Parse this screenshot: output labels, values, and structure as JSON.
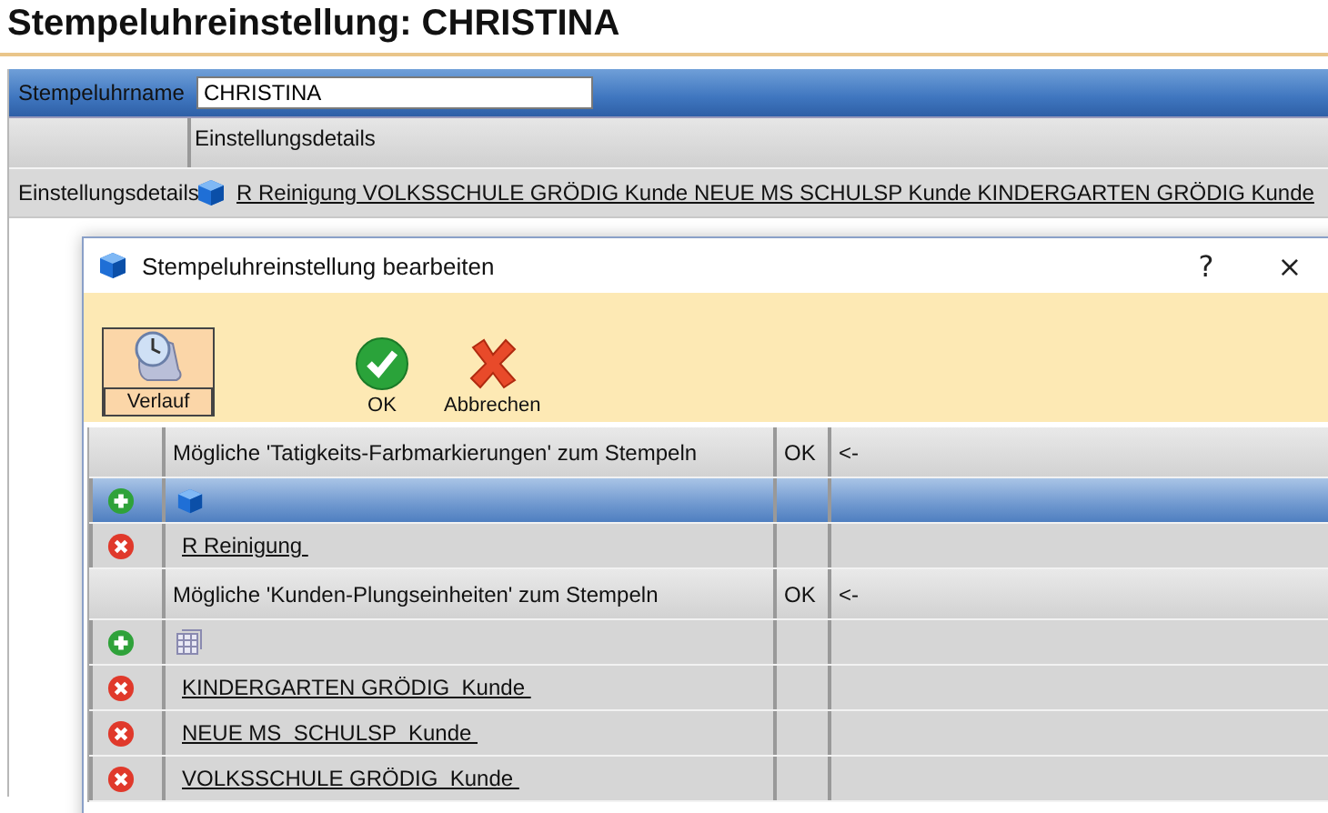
{
  "page_title": "Stempeluhreinstellung: CHRISTINA",
  "form": {
    "name_label": "Stempeluhrname",
    "name_value": "CHRISTINA",
    "column_header": "Einstellungsdetails",
    "details_label": "Einstellungsdetails",
    "details_link": "R Reinigung VOLKSSCHULE GRÖDIG  Kunde NEUE MS  SCHULSP  Kunde KINDERGARTEN GRÖDIG  Kunde"
  },
  "dialog": {
    "title": "Stempeluhreinstellung bearbeiten",
    "help": "?",
    "close": "×",
    "toolbar": [
      {
        "kind": "history",
        "label": "Verlauf"
      },
      {
        "kind": "ok",
        "label": "OK"
      },
      {
        "kind": "cancel",
        "label": "Abbrechen"
      }
    ],
    "sections": [
      {
        "header": "Mögliche 'Tatigkeits-Farbmarkierungen' zum Stempeln",
        "ok_header": "OK",
        "arrow_header": "<-",
        "add_row": {
          "kind": "cube",
          "selected": true
        },
        "items": [
          "R Reinigung "
        ]
      },
      {
        "header": "Mögliche 'Kunden-Plungseinheiten' zum Stempeln",
        "ok_header": "OK",
        "arrow_header": "<-",
        "add_row": {
          "kind": "grid",
          "selected": false
        },
        "items": [
          "KINDERGARTEN GRÖDIG  Kunde ",
          "NEUE MS  SCHULSP  Kunde ",
          "VOLKSSCHULE GRÖDIG  Kunde "
        ]
      }
    ]
  }
}
